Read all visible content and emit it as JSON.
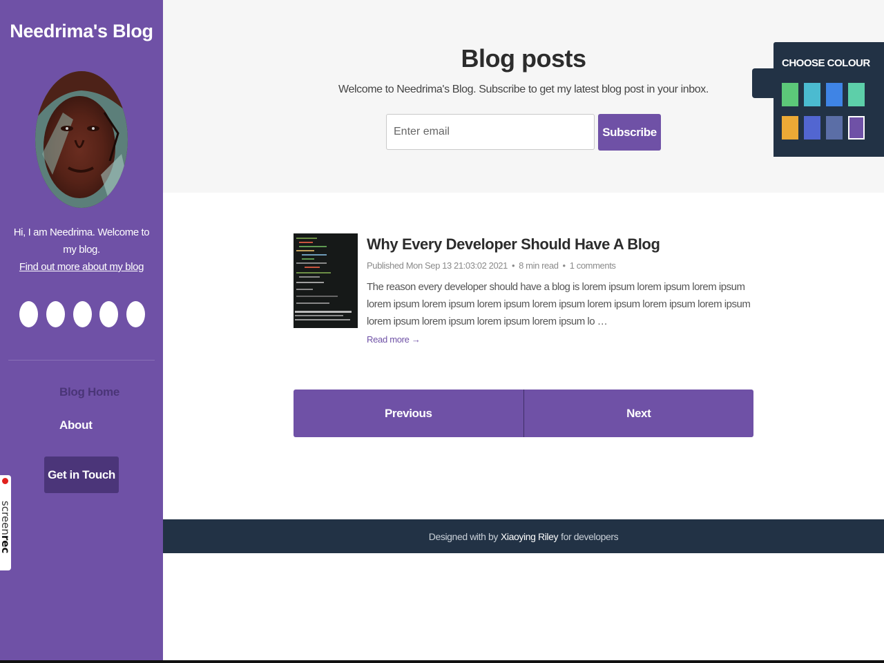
{
  "sidebar": {
    "blog_name": "Needrima's Blog",
    "bio_line": "Hi, I am Needrima. Welcome to my blog.",
    "bio_link": "Find out more about my blog",
    "social_icons": [
      "social-icon-1",
      "social-icon-2",
      "social-icon-3",
      "social-icon-4",
      "social-icon-5"
    ],
    "nav": {
      "home": "Blog Home",
      "about": "About"
    },
    "cta": "Get in Touch"
  },
  "header": {
    "title": "Blog posts",
    "subtitle": "Welcome to Needrima's Blog. Subscribe to get my latest blog post in your inbox.",
    "email_placeholder": "Enter email",
    "subscribe_label": "Subscribe"
  },
  "colour_panel": {
    "title": "CHOOSE COLOUR",
    "swatches": [
      "#5cc879",
      "#4bbbd0",
      "#3f84e5",
      "#5dcfa9",
      "#eca936",
      "#5266d1",
      "#5b6ea6",
      "#6f51a6"
    ],
    "active_index": 7
  },
  "post": {
    "title": "Why Every Developer Should Have A Blog",
    "published": "Published Mon Sep 13 21:03:02 2021",
    "read_time": "8 min read",
    "comments": "1 comments",
    "excerpt": "The reason every developer should have a blog is lorem ipsum lorem ipsum lorem ipsum lorem ipsum lorem ipsum lorem ipsum lorem ipsum lorem ipsum lorem ipsum lorem ipsum lorem ipsum lorem ipsum lorem ipsum lorem ipsum lo …",
    "read_more": "Read more →"
  },
  "pagination": {
    "previous": "Previous",
    "next": "Next"
  },
  "footer": {
    "prefix": "Designed with by",
    "author": "Xiaoying Riley",
    "suffix": "for developers"
  },
  "overlay": {
    "recorder_brand": "screen",
    "recorder_brand_bold": "rec"
  },
  "colors": {
    "accent": "#6f51a6",
    "dark": "#223245",
    "button_dark": "#4b3579"
  }
}
